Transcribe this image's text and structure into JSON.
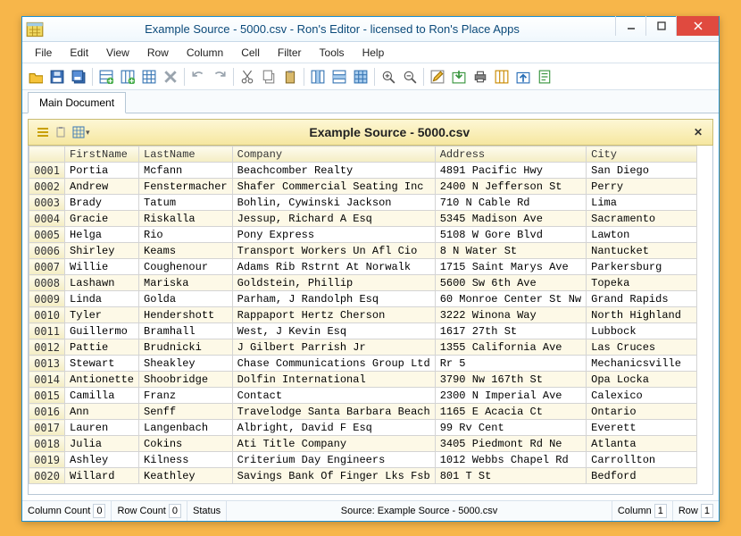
{
  "titlebar": {
    "title": "Example Source - 5000.csv - Ron's Editor - licensed to Ron's Place Apps"
  },
  "menu": [
    "File",
    "Edit",
    "View",
    "Row",
    "Column",
    "Cell",
    "Filter",
    "Tools",
    "Help"
  ],
  "toolbar_icons": [
    "open-file-icon",
    "save-icon",
    "save-all-icon",
    "sep",
    "add-row-icon",
    "add-column-icon",
    "grid-config-icon",
    "delete-icon",
    "sep",
    "undo-icon",
    "redo-icon",
    "sep",
    "cut-icon",
    "copy-icon",
    "paste-icon",
    "sep",
    "select-col-icon",
    "select-row-icon",
    "select-grid-icon",
    "sep",
    "zoom-in-icon",
    "zoom-out-icon",
    "sep",
    "edit-cell-icon",
    "export-icon",
    "print-icon",
    "columns-icon",
    "import-icon",
    "script-icon"
  ],
  "tabs": [
    {
      "label": "Main Document"
    }
  ],
  "document": {
    "title": "Example Source - 5000.csv",
    "close_label": "✕"
  },
  "columns": [
    "FirstName",
    "LastName",
    "Company",
    "Address",
    "City"
  ],
  "rows": [
    {
      "n": "0001",
      "c": [
        "Portia",
        "Mcfann",
        "Beachcomber Realty",
        "4891 Pacific Hwy",
        "San Diego"
      ]
    },
    {
      "n": "0002",
      "c": [
        "Andrew",
        "Fenstermacher",
        "Shafer Commercial Seating Inc",
        "2400 N Jefferson St",
        "Perry"
      ]
    },
    {
      "n": "0003",
      "c": [
        "Brady",
        "Tatum",
        "Bohlin, Cywinski Jackson",
        "710 N Cable Rd",
        "Lima"
      ]
    },
    {
      "n": "0004",
      "c": [
        "Gracie",
        "Riskalla",
        "Jessup, Richard A Esq",
        "5345 Madison Ave",
        "Sacramento"
      ]
    },
    {
      "n": "0005",
      "c": [
        "Helga",
        "Rio",
        "Pony Express",
        "5108 W Gore Blvd",
        "Lawton"
      ]
    },
    {
      "n": "0006",
      "c": [
        "Shirley",
        "Keams",
        "Transport Workers Un Afl Cio",
        "8 N Water St",
        "Nantucket"
      ]
    },
    {
      "n": "0007",
      "c": [
        "Willie",
        "Coughenour",
        "Adams Rib Rstrnt At Norwalk",
        "1715 Saint Marys Ave",
        "Parkersburg"
      ]
    },
    {
      "n": "0008",
      "c": [
        "Lashawn",
        "Mariska",
        "Goldstein, Phillip",
        "5600 Sw 6th Ave",
        "Topeka"
      ]
    },
    {
      "n": "0009",
      "c": [
        "Linda",
        "Golda",
        "Parham, J Randolph Esq",
        "60 Monroe Center St Nw",
        "Grand Rapids"
      ]
    },
    {
      "n": "0010",
      "c": [
        "Tyler",
        "Hendershott",
        "Rappaport Hertz Cherson",
        "3222 Winona Way",
        "North Highland"
      ]
    },
    {
      "n": "0011",
      "c": [
        "Guillermo",
        "Bramhall",
        "West, J Kevin Esq",
        "1617 27th St",
        "Lubbock"
      ]
    },
    {
      "n": "0012",
      "c": [
        "Pattie",
        "Brudnicki",
        "J Gilbert Parrish Jr",
        "1355 California Ave",
        "Las Cruces"
      ]
    },
    {
      "n": "0013",
      "c": [
        "Stewart",
        "Sheakley",
        "Chase Communications Group Ltd",
        "Rr 5",
        "Mechanicsville"
      ]
    },
    {
      "n": "0014",
      "c": [
        "Antionette",
        "Shoobridge",
        "Dolfin International",
        "3790 Nw 167th St",
        "Opa Locka"
      ]
    },
    {
      "n": "0015",
      "c": [
        "Camilla",
        "Franz",
        "Contact",
        "2300 N Imperial Ave",
        "Calexico"
      ]
    },
    {
      "n": "0016",
      "c": [
        "Ann",
        "Senff",
        "Travelodge Santa Barbara Beach",
        "1165 E Acacia Ct",
        "Ontario"
      ]
    },
    {
      "n": "0017",
      "c": [
        "Lauren",
        "Langenbach",
        "Albright, David F Esq",
        "99 Rv Cent",
        "Everett"
      ]
    },
    {
      "n": "0018",
      "c": [
        "Julia",
        "Cokins",
        "Ati Title Company",
        "3405 Piedmont Rd Ne",
        "Atlanta"
      ]
    },
    {
      "n": "0019",
      "c": [
        "Ashley",
        "Kilness",
        "Criterium Day Engineers",
        "1012 Webbs Chapel Rd",
        "Carrollton"
      ]
    },
    {
      "n": "0020",
      "c": [
        "Willard",
        "Keathley",
        "Savings Bank Of Finger Lks Fsb",
        "801 T St",
        "Bedford"
      ]
    }
  ],
  "status": {
    "col_count_label": "Column Count",
    "col_count_val": "0",
    "row_count_label": "Row Count",
    "row_count_val": "0",
    "status_label": "Status",
    "source_label": "Source: Example Source - 5000.csv",
    "column_label": "Column",
    "column_val": "1",
    "row_label": "Row",
    "row_val": "1"
  }
}
